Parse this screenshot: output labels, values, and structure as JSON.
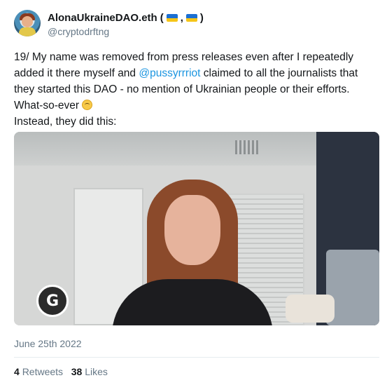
{
  "author": {
    "display_name": "AlonaUkraineDAO.eth",
    "flags_open": "(",
    "flags_sep": ",",
    "flags_close": ")",
    "handle": "@cryptodrftng",
    "flag_colors": [
      "#1c6fd1",
      "#f5c518"
    ],
    "avatar_icon": "avatar-image"
  },
  "tweet": {
    "text_part1": "19/ My name was removed from press releases even after I repeatedly added it there myself and ",
    "mention": "@pussyrrriot",
    "text_part2": " claimed to all the journalists that they started this DAO - no mention of Ukrainian people or their efforts. What-so-ever ",
    "emoji_icon": "upside-down-face-emoji",
    "text_line_last": "Instead, they did this:",
    "video_logo": "G",
    "date": "June 25th 2022"
  },
  "stats": {
    "retweets_count": "4",
    "retweets_label": "Retweets",
    "likes_count": "38",
    "likes_label": "Likes"
  },
  "colors": {
    "mention": "#1b95e0",
    "secondary_text": "#657786",
    "primary_text": "#14171a"
  }
}
